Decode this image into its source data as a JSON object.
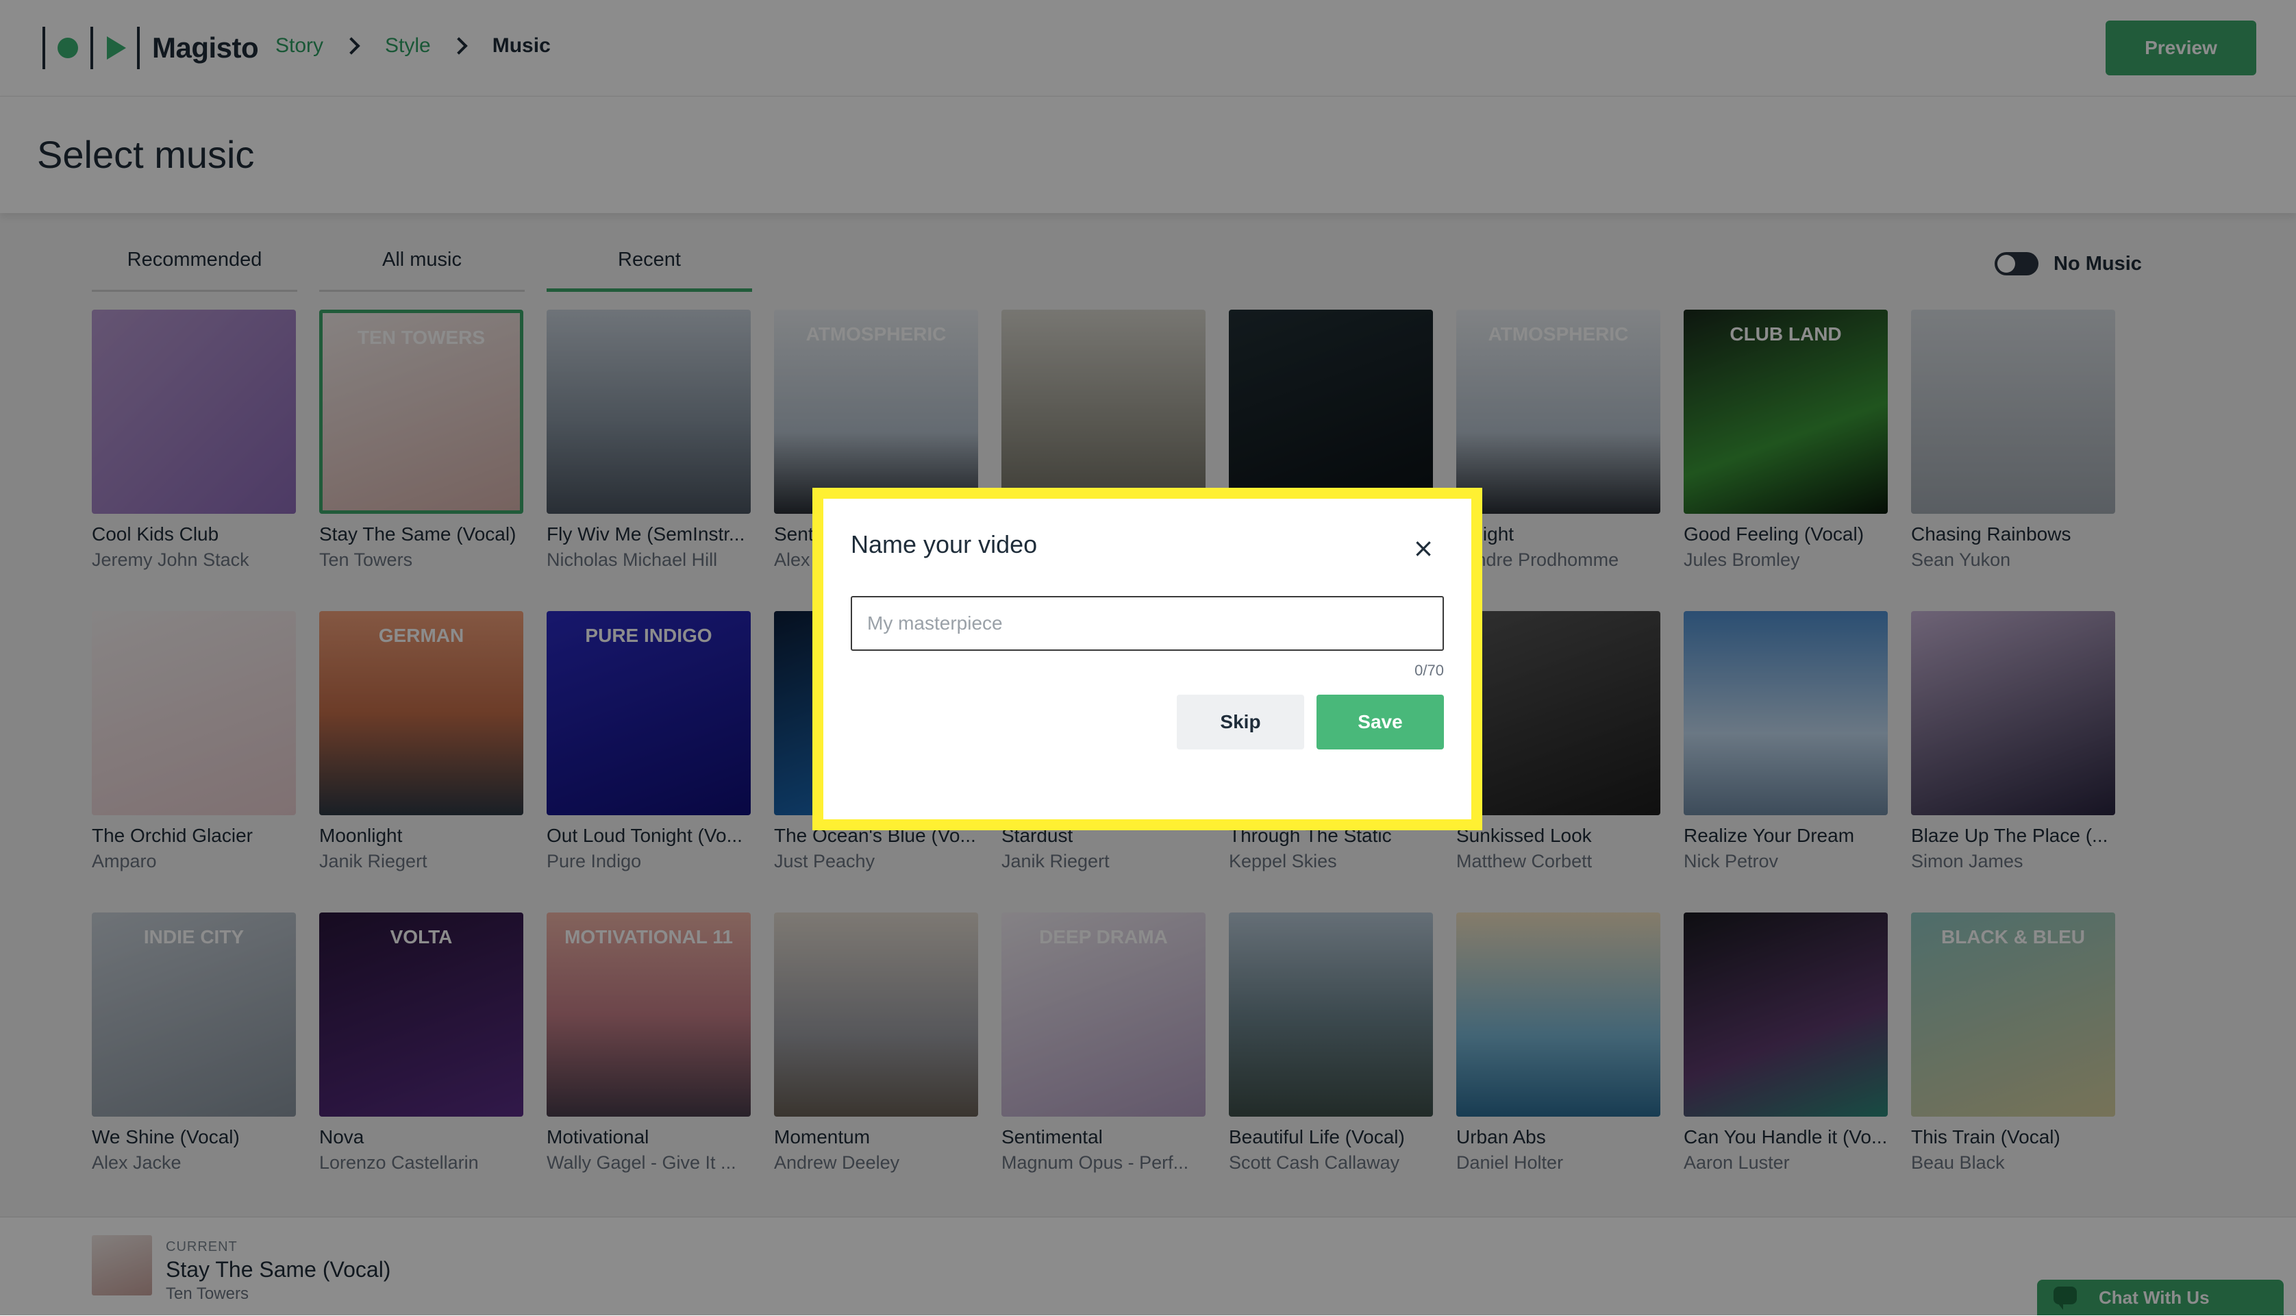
{
  "app": {
    "name": "Magisto",
    "breadcrumbs": [
      {
        "label": "Story",
        "current": false
      },
      {
        "label": "Style",
        "current": false
      },
      {
        "label": "Music",
        "current": true
      }
    ],
    "preview_label": "Preview"
  },
  "page": {
    "title": "Select music",
    "tabs": [
      {
        "label": "Recommended",
        "active": false
      },
      {
        "label": "All music",
        "active": false
      },
      {
        "label": "Recent",
        "active": true
      }
    ],
    "no_music": {
      "label": "No Music",
      "enabled": false
    }
  },
  "tracks": [
    {
      "song": "Cool Kids Club",
      "artist": "Jeremy John Stack",
      "selected": false,
      "cover_text": ""
    },
    {
      "song": "Stay The Same (Vocal)",
      "artist": "Ten Towers",
      "selected": true,
      "cover_text": "TEN TOWERS"
    },
    {
      "song": "Fly Wiv Me (SemInstr...",
      "artist": "Nicholas Michael Hill",
      "selected": false,
      "cover_text": ""
    },
    {
      "song": "Sent",
      "artist": "Alex",
      "selected": false,
      "cover_text": "ATMOSPHERIC"
    },
    {
      "song": "",
      "artist": "",
      "selected": false,
      "cover_text": ""
    },
    {
      "song": "",
      "artist": "",
      "selected": false,
      "cover_text": ""
    },
    {
      "song": "n Light",
      "artist": "xandre Prodhomme",
      "selected": false,
      "cover_text": "ATMOSPHERIC"
    },
    {
      "song": "Good Feeling (Vocal)",
      "artist": "Jules Bromley",
      "selected": false,
      "cover_text": "CLUB LAND"
    },
    {
      "song": "Chasing Rainbows",
      "artist": "Sean Yukon",
      "selected": false,
      "cover_text": ""
    },
    {
      "song": "The Orchid Glacier",
      "artist": "Amparo",
      "selected": false,
      "cover_text": ""
    },
    {
      "song": "Moonlight",
      "artist": "Janik Riegert",
      "selected": false,
      "cover_text": "GERMAN"
    },
    {
      "song": "Out Loud Tonight (Vo...",
      "artist": "Pure Indigo",
      "selected": false,
      "cover_text": "PURE INDIGO"
    },
    {
      "song": "The Ocean's Blue (Vo...",
      "artist": "Just Peachy",
      "selected": false,
      "cover_text": ""
    },
    {
      "song": "Stardust",
      "artist": "Janik Riegert",
      "selected": false,
      "cover_text": ""
    },
    {
      "song": "Through The Static",
      "artist": "Keppel Skies",
      "selected": false,
      "cover_text": ""
    },
    {
      "song": "Sunkissed Look",
      "artist": "Matthew Corbett",
      "selected": false,
      "cover_text": ""
    },
    {
      "song": "Realize Your Dream",
      "artist": "Nick Petrov",
      "selected": false,
      "cover_text": ""
    },
    {
      "song": "Blaze Up The Place (...",
      "artist": "Simon James",
      "selected": false,
      "cover_text": ""
    },
    {
      "song": "We Shine (Vocal)",
      "artist": "Alex Jacke",
      "selected": false,
      "cover_text": "INDIE CITY"
    },
    {
      "song": "Nova",
      "artist": "Lorenzo Castellarin",
      "selected": false,
      "cover_text": "VOLTA"
    },
    {
      "song": "Motivational",
      "artist": "Wally Gagel - Give It ...",
      "selected": false,
      "cover_text": "MOTIVATIONAL 11"
    },
    {
      "song": "Momentum",
      "artist": "Andrew Deeley",
      "selected": false,
      "cover_text": ""
    },
    {
      "song": "Sentimental",
      "artist": "Magnum Opus - Perf...",
      "selected": false,
      "cover_text": "DEEP DRAMA"
    },
    {
      "song": "Beautiful Life (Vocal)",
      "artist": "Scott Cash Callaway",
      "selected": false,
      "cover_text": ""
    },
    {
      "song": "Urban Abs",
      "artist": "Daniel Holter",
      "selected": false,
      "cover_text": ""
    },
    {
      "song": "Can You Handle it (Vo...",
      "artist": "Aaron Luster",
      "selected": false,
      "cover_text": ""
    },
    {
      "song": "This Train (Vocal)",
      "artist": "Beau Black",
      "selected": false,
      "cover_text": "BLACK & BLEU"
    }
  ],
  "now_playing": {
    "label": "CURRENT",
    "song": "Stay The Same (Vocal)",
    "artist": "Ten Towers"
  },
  "chat": {
    "label": "Chat With Us"
  },
  "modal": {
    "title": "Name your video",
    "close_icon": "×",
    "input_value": "",
    "input_placeholder": "My masterpiece",
    "counter": "0/70",
    "skip_label": "Skip",
    "save_label": "Save"
  },
  "colors": {
    "accent": "#3ca66b",
    "highlight_border": "#fff032",
    "text_dark": "#1f2d3a",
    "text_muted": "#6b7480"
  }
}
